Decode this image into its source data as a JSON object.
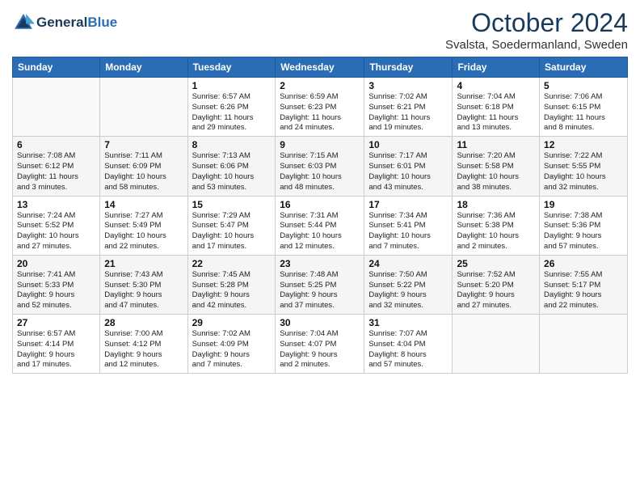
{
  "header": {
    "logo_line1": "General",
    "logo_line2": "Blue",
    "month": "October 2024",
    "location": "Svalsta, Soedermanland, Sweden"
  },
  "weekdays": [
    "Sunday",
    "Monday",
    "Tuesday",
    "Wednesday",
    "Thursday",
    "Friday",
    "Saturday"
  ],
  "weeks": [
    [
      {
        "day": "",
        "info": ""
      },
      {
        "day": "",
        "info": ""
      },
      {
        "day": "1",
        "info": "Sunrise: 6:57 AM\nSunset: 6:26 PM\nDaylight: 11 hours\nand 29 minutes."
      },
      {
        "day": "2",
        "info": "Sunrise: 6:59 AM\nSunset: 6:23 PM\nDaylight: 11 hours\nand 24 minutes."
      },
      {
        "day": "3",
        "info": "Sunrise: 7:02 AM\nSunset: 6:21 PM\nDaylight: 11 hours\nand 19 minutes."
      },
      {
        "day": "4",
        "info": "Sunrise: 7:04 AM\nSunset: 6:18 PM\nDaylight: 11 hours\nand 13 minutes."
      },
      {
        "day": "5",
        "info": "Sunrise: 7:06 AM\nSunset: 6:15 PM\nDaylight: 11 hours\nand 8 minutes."
      }
    ],
    [
      {
        "day": "6",
        "info": "Sunrise: 7:08 AM\nSunset: 6:12 PM\nDaylight: 11 hours\nand 3 minutes."
      },
      {
        "day": "7",
        "info": "Sunrise: 7:11 AM\nSunset: 6:09 PM\nDaylight: 10 hours\nand 58 minutes."
      },
      {
        "day": "8",
        "info": "Sunrise: 7:13 AM\nSunset: 6:06 PM\nDaylight: 10 hours\nand 53 minutes."
      },
      {
        "day": "9",
        "info": "Sunrise: 7:15 AM\nSunset: 6:03 PM\nDaylight: 10 hours\nand 48 minutes."
      },
      {
        "day": "10",
        "info": "Sunrise: 7:17 AM\nSunset: 6:01 PM\nDaylight: 10 hours\nand 43 minutes."
      },
      {
        "day": "11",
        "info": "Sunrise: 7:20 AM\nSunset: 5:58 PM\nDaylight: 10 hours\nand 38 minutes."
      },
      {
        "day": "12",
        "info": "Sunrise: 7:22 AM\nSunset: 5:55 PM\nDaylight: 10 hours\nand 32 minutes."
      }
    ],
    [
      {
        "day": "13",
        "info": "Sunrise: 7:24 AM\nSunset: 5:52 PM\nDaylight: 10 hours\nand 27 minutes."
      },
      {
        "day": "14",
        "info": "Sunrise: 7:27 AM\nSunset: 5:49 PM\nDaylight: 10 hours\nand 22 minutes."
      },
      {
        "day": "15",
        "info": "Sunrise: 7:29 AM\nSunset: 5:47 PM\nDaylight: 10 hours\nand 17 minutes."
      },
      {
        "day": "16",
        "info": "Sunrise: 7:31 AM\nSunset: 5:44 PM\nDaylight: 10 hours\nand 12 minutes."
      },
      {
        "day": "17",
        "info": "Sunrise: 7:34 AM\nSunset: 5:41 PM\nDaylight: 10 hours\nand 7 minutes."
      },
      {
        "day": "18",
        "info": "Sunrise: 7:36 AM\nSunset: 5:38 PM\nDaylight: 10 hours\nand 2 minutes."
      },
      {
        "day": "19",
        "info": "Sunrise: 7:38 AM\nSunset: 5:36 PM\nDaylight: 9 hours\nand 57 minutes."
      }
    ],
    [
      {
        "day": "20",
        "info": "Sunrise: 7:41 AM\nSunset: 5:33 PM\nDaylight: 9 hours\nand 52 minutes."
      },
      {
        "day": "21",
        "info": "Sunrise: 7:43 AM\nSunset: 5:30 PM\nDaylight: 9 hours\nand 47 minutes."
      },
      {
        "day": "22",
        "info": "Sunrise: 7:45 AM\nSunset: 5:28 PM\nDaylight: 9 hours\nand 42 minutes."
      },
      {
        "day": "23",
        "info": "Sunrise: 7:48 AM\nSunset: 5:25 PM\nDaylight: 9 hours\nand 37 minutes."
      },
      {
        "day": "24",
        "info": "Sunrise: 7:50 AM\nSunset: 5:22 PM\nDaylight: 9 hours\nand 32 minutes."
      },
      {
        "day": "25",
        "info": "Sunrise: 7:52 AM\nSunset: 5:20 PM\nDaylight: 9 hours\nand 27 minutes."
      },
      {
        "day": "26",
        "info": "Sunrise: 7:55 AM\nSunset: 5:17 PM\nDaylight: 9 hours\nand 22 minutes."
      }
    ],
    [
      {
        "day": "27",
        "info": "Sunrise: 6:57 AM\nSunset: 4:14 PM\nDaylight: 9 hours\nand 17 minutes."
      },
      {
        "day": "28",
        "info": "Sunrise: 7:00 AM\nSunset: 4:12 PM\nDaylight: 9 hours\nand 12 minutes."
      },
      {
        "day": "29",
        "info": "Sunrise: 7:02 AM\nSunset: 4:09 PM\nDaylight: 9 hours\nand 7 minutes."
      },
      {
        "day": "30",
        "info": "Sunrise: 7:04 AM\nSunset: 4:07 PM\nDaylight: 9 hours\nand 2 minutes."
      },
      {
        "day": "31",
        "info": "Sunrise: 7:07 AM\nSunset: 4:04 PM\nDaylight: 8 hours\nand 57 minutes."
      },
      {
        "day": "",
        "info": ""
      },
      {
        "day": "",
        "info": ""
      }
    ]
  ]
}
